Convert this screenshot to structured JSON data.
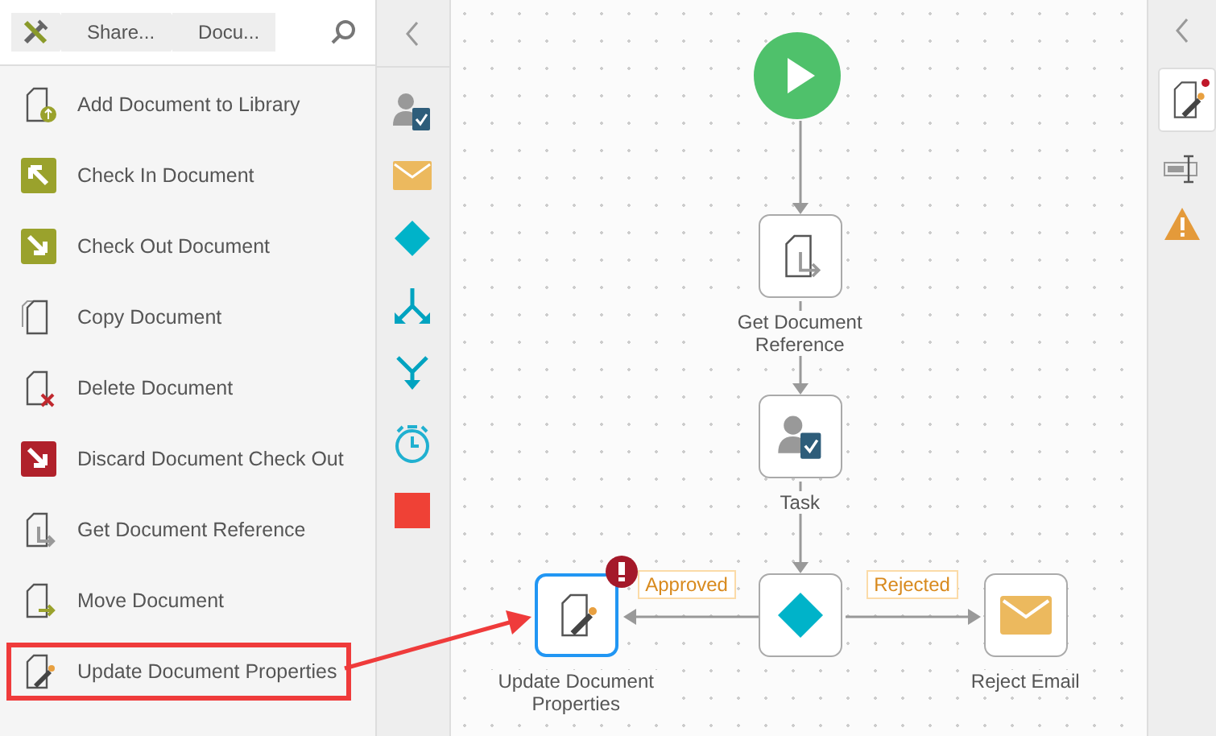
{
  "breadcrumb": [
    "Share...",
    "Docu..."
  ],
  "toolbox": [
    {
      "label": "Add Document to Library",
      "kind": "add",
      "highlighted": false
    },
    {
      "label": "Check In Document",
      "kind": "checkin",
      "highlighted": false
    },
    {
      "label": "Check Out Document",
      "kind": "checkout",
      "highlighted": false
    },
    {
      "label": "Copy Document",
      "kind": "copy",
      "highlighted": false
    },
    {
      "label": "Delete Document",
      "kind": "delete",
      "highlighted": false
    },
    {
      "label": "Discard Document Check Out",
      "kind": "discard",
      "highlighted": false
    },
    {
      "label": "Get Document Reference",
      "kind": "getref",
      "highlighted": false
    },
    {
      "label": "Move Document",
      "kind": "move",
      "highlighted": false
    },
    {
      "label": "Update Document Properties",
      "kind": "update",
      "highlighted": true
    }
  ],
  "nodes": [
    {
      "kind": "start",
      "selected": false,
      "error": false
    },
    {
      "kind": "getref",
      "label": "Get Document Reference",
      "selected": false,
      "error": false
    },
    {
      "kind": "task",
      "label": "Task",
      "selected": false,
      "error": false
    },
    {
      "kind": "decision",
      "selected": false,
      "error": false
    },
    {
      "kind": "update",
      "label": "Update Document Properties",
      "selected": true,
      "error": true
    },
    {
      "kind": "email",
      "label": "Reject Email",
      "selected": false,
      "error": false
    }
  ],
  "edge_labels": [
    "Approved",
    "Rejected"
  ]
}
